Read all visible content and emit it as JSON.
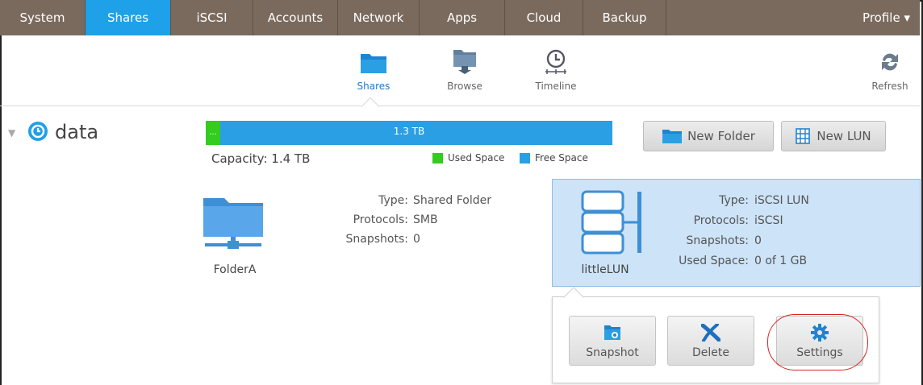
{
  "topnav": {
    "tabs": [
      {
        "label": "System",
        "width": 0
      },
      {
        "label": "Shares"
      },
      {
        "label": "iSCSI"
      },
      {
        "label": "Accounts"
      },
      {
        "label": "Network"
      },
      {
        "label": "Apps"
      },
      {
        "label": "Cloud"
      },
      {
        "label": "Backup"
      }
    ],
    "profile_label": "Profile ▾",
    "active_tab": "Shares"
  },
  "subbar": {
    "shares_label": "Shares",
    "browse_label": "Browse",
    "timeline_label": "Timeline",
    "refresh_label": "Refresh"
  },
  "volume": {
    "name": "data",
    "used_label": "...",
    "free_label": "1.3 TB",
    "capacity": "Capacity: 1.4 TB",
    "legend_used": "Used Space",
    "legend_free": "Free Space",
    "used_color": "#33cc1f",
    "free_color": "#2b9fe3"
  },
  "actions": {
    "new_folder": "New Folder",
    "new_lun": "New LUN"
  },
  "folder": {
    "name": "FolderA",
    "type_key": "Type:",
    "type_val": "Shared Folder",
    "protocols_key": "Protocols:",
    "protocols_val": "SMB",
    "snapshots_key": "Snapshots:",
    "snapshots_val": "0"
  },
  "lun": {
    "name": "littleLUN",
    "type_key": "Type:",
    "type_val": "iSCSI LUN",
    "protocols_key": "Protocols:",
    "protocols_val": "iSCSI",
    "snapshots_key": "Snapshots:",
    "snapshots_val": "0",
    "used_key": "Used Space:",
    "used_val": "0 of 1 GB"
  },
  "popover": {
    "snapshot": "Snapshot",
    "delete": "Delete",
    "settings": "Settings"
  }
}
